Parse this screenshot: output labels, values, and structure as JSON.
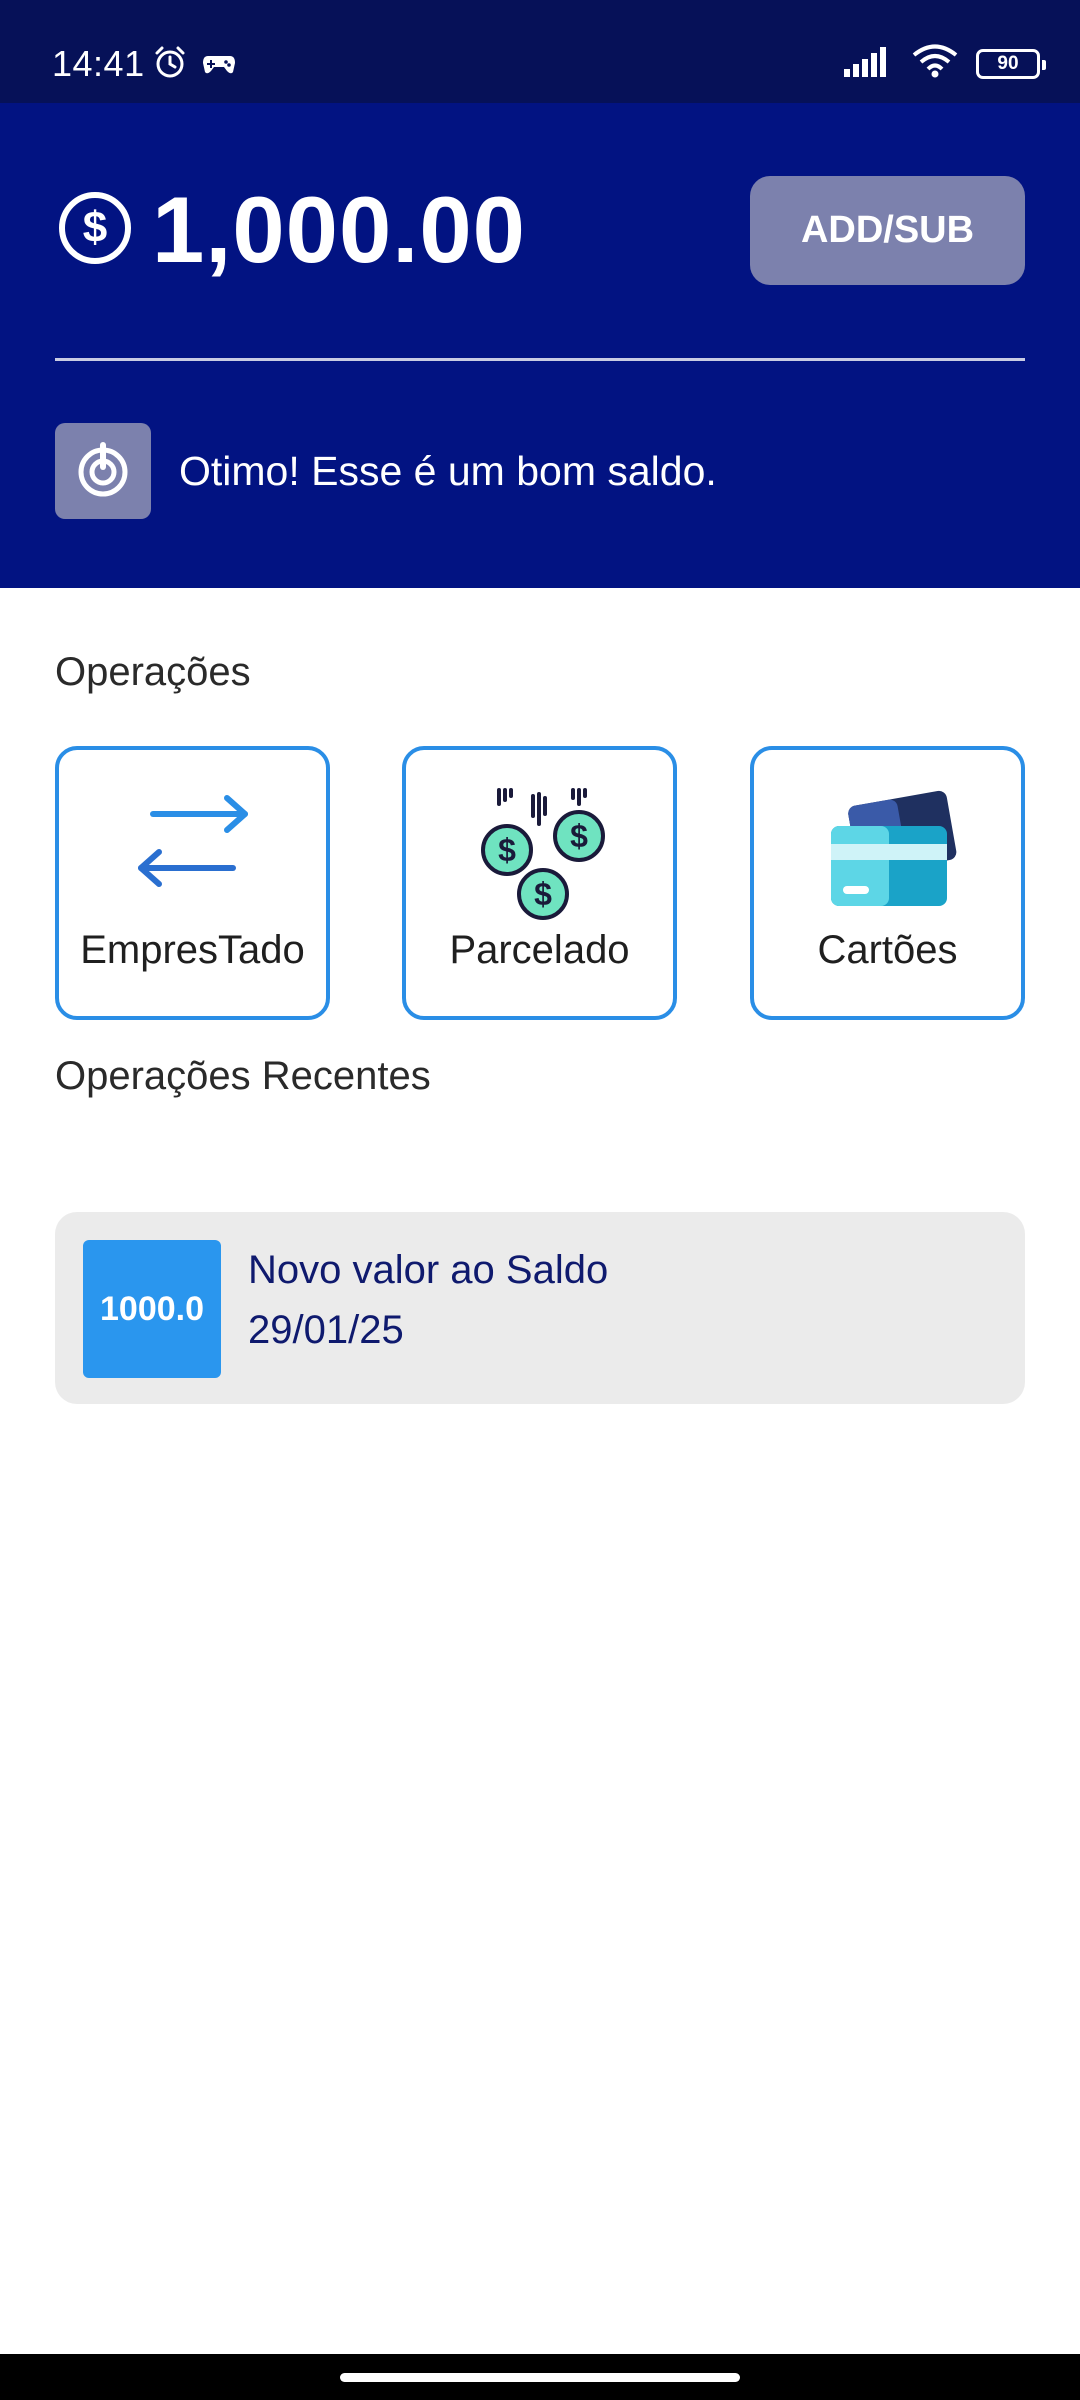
{
  "status_bar": {
    "time": "14:41",
    "battery": "90",
    "icons": [
      "alarm-icon",
      "gamepad-icon",
      "signal-icon",
      "wifi-icon",
      "battery-icon"
    ]
  },
  "header": {
    "balance": "1,000.00",
    "add_sub_label": "ADD/SUB",
    "tip_text": "Otimo! Esse é um bom saldo.",
    "background_color": "#021382",
    "button_color": "#7c81ad"
  },
  "operations": {
    "title": "Operações",
    "items": [
      {
        "label": "EmpresTado",
        "icon": "transfer-arrows-icon"
      },
      {
        "label": "Parcelado",
        "icon": "coins-icon"
      },
      {
        "label": "Cartões",
        "icon": "credit-cards-icon"
      }
    ],
    "border_color": "#2a8ee6"
  },
  "recent": {
    "title": "Operações Recentes",
    "items": [
      {
        "amount": "1000.0",
        "description": "Novo valor ao Saldo",
        "date": "29/01/25"
      }
    ],
    "badge_color": "#2a96ee"
  }
}
